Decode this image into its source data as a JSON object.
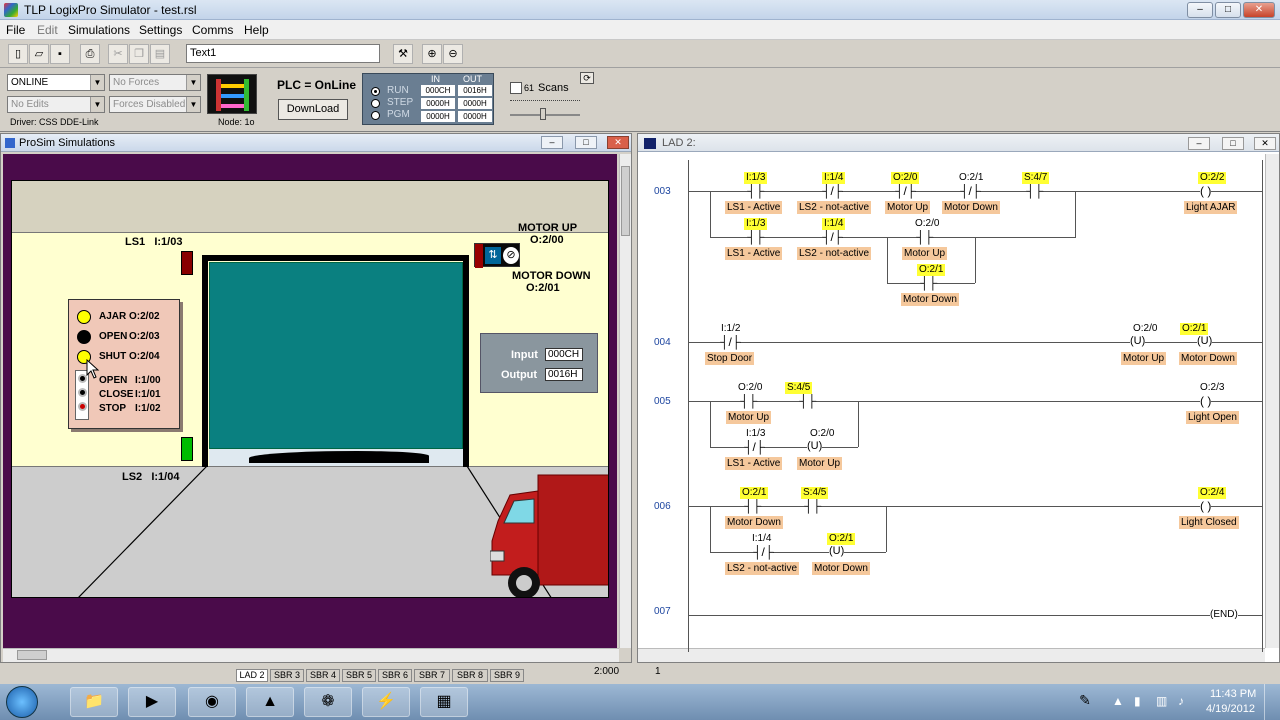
{
  "app": {
    "title": "TLP LogixPro Simulator  -  test.rsl"
  },
  "menu": [
    "File",
    "Edit",
    "Simulations",
    "Settings",
    "Comms",
    "Help"
  ],
  "toolbar": {
    "text_field": "Text1"
  },
  "plc": {
    "mode": "ONLINE",
    "forces": "No Forces",
    "edits": "No Edits",
    "forces_state": "Forces Disabled",
    "driver": "Driver: CSS DDE-Link",
    "node": "Node: 1o",
    "status": "PLC = OnLine",
    "download_label": "DownLoad",
    "run_label": "RUN",
    "step_label": "STEP",
    "pgm_label": "PGM",
    "in_label": "IN",
    "out_label": "OUT",
    "in_values": [
      "000CH",
      "0000H",
      "0000H"
    ],
    "out_values": [
      "0016H",
      "0000H",
      "0000H"
    ],
    "scans": "61",
    "scans_label": "Scans"
  },
  "prosim": {
    "title": "ProSim Simulations",
    "motor_up": "MOTOR UP",
    "motor_up_addr": "O:2/00",
    "motor_down": "MOTOR DOWN",
    "motor_down_addr": "O:2/01",
    "ls1": "LS1   I:1/03",
    "ls2": "LS2   I:1/04",
    "panel": [
      {
        "label": "AJAR",
        "addr": "O:2/02",
        "color": "#ffff00"
      },
      {
        "label": "OPEN",
        "addr": "O:2/03",
        "color": "#000000"
      },
      {
        "label": "SHUT",
        "addr": "O:2/04",
        "color": "#ffff00"
      }
    ],
    "buttons": [
      {
        "label": "OPEN",
        "addr": "I:1/00"
      },
      {
        "label": "CLOSE",
        "addr": "I:1/01"
      },
      {
        "label": "STOP",
        "addr": "I:1/02"
      }
    ],
    "io_input_label": "Input",
    "io_input_value": "000CH",
    "io_output_label": "Output",
    "io_output_value": "0016H"
  },
  "lad": {
    "title": "LAD 2:",
    "rungs": [
      "003",
      "004",
      "005",
      "006",
      "007"
    ],
    "end_label": "END",
    "coil_u": "U",
    "r003": {
      "a1": "I:1/3",
      "t1": "LS1 - Active",
      "a2": "I:1/4",
      "t2": "LS2 - not-active",
      "a3": "O:2/0",
      "t3": "Motor Up",
      "a4": "O:2/1",
      "t4": "Motor Down",
      "a5": "S:4/7",
      "a6": "I:1/3",
      "t6": "LS1 - Active",
      "a7": "I:1/4",
      "t7": "LS2 - not-active",
      "a8": "O:2/0",
      "t8": "Motor Up",
      "a9": "O:2/1",
      "t9": "Motor Down",
      "coil_a": "O:2/2",
      "coil_t": "Light AJAR"
    },
    "r004": {
      "a1": "I:1/2",
      "t1": "Stop Door",
      "c1a": "O:2/0",
      "c1t": "Motor Up",
      "c2a": "O:2/1",
      "c2t": "Motor Down"
    },
    "r005": {
      "a1": "O:2/0",
      "t1": "Motor Up",
      "a2": "S:4/5",
      "a3": "I:1/3",
      "t3": "LS1 - Active",
      "a4": "O:2/0",
      "t4": "Motor Up",
      "coil_a": "O:2/3",
      "coil_t": "Light Open"
    },
    "r006": {
      "a1": "O:2/1",
      "t1": "Motor Down",
      "a2": "S:4/5",
      "a3": "I:1/4",
      "t3": "LS2 - not-active",
      "a4": "O:2/1",
      "t4": "Motor Down",
      "coil_a": "O:2/4",
      "coil_t": "Light Closed"
    }
  },
  "tabs": [
    "LAD 2",
    "SBR 3",
    "SBR 4",
    "SBR 5",
    "SBR 6",
    "SBR 7",
    "SBR 8",
    "SBR 9"
  ],
  "status": {
    "left": "2:000",
    "right": "1"
  },
  "clock": {
    "time": "11:43 PM",
    "date": "4/19/2012"
  }
}
